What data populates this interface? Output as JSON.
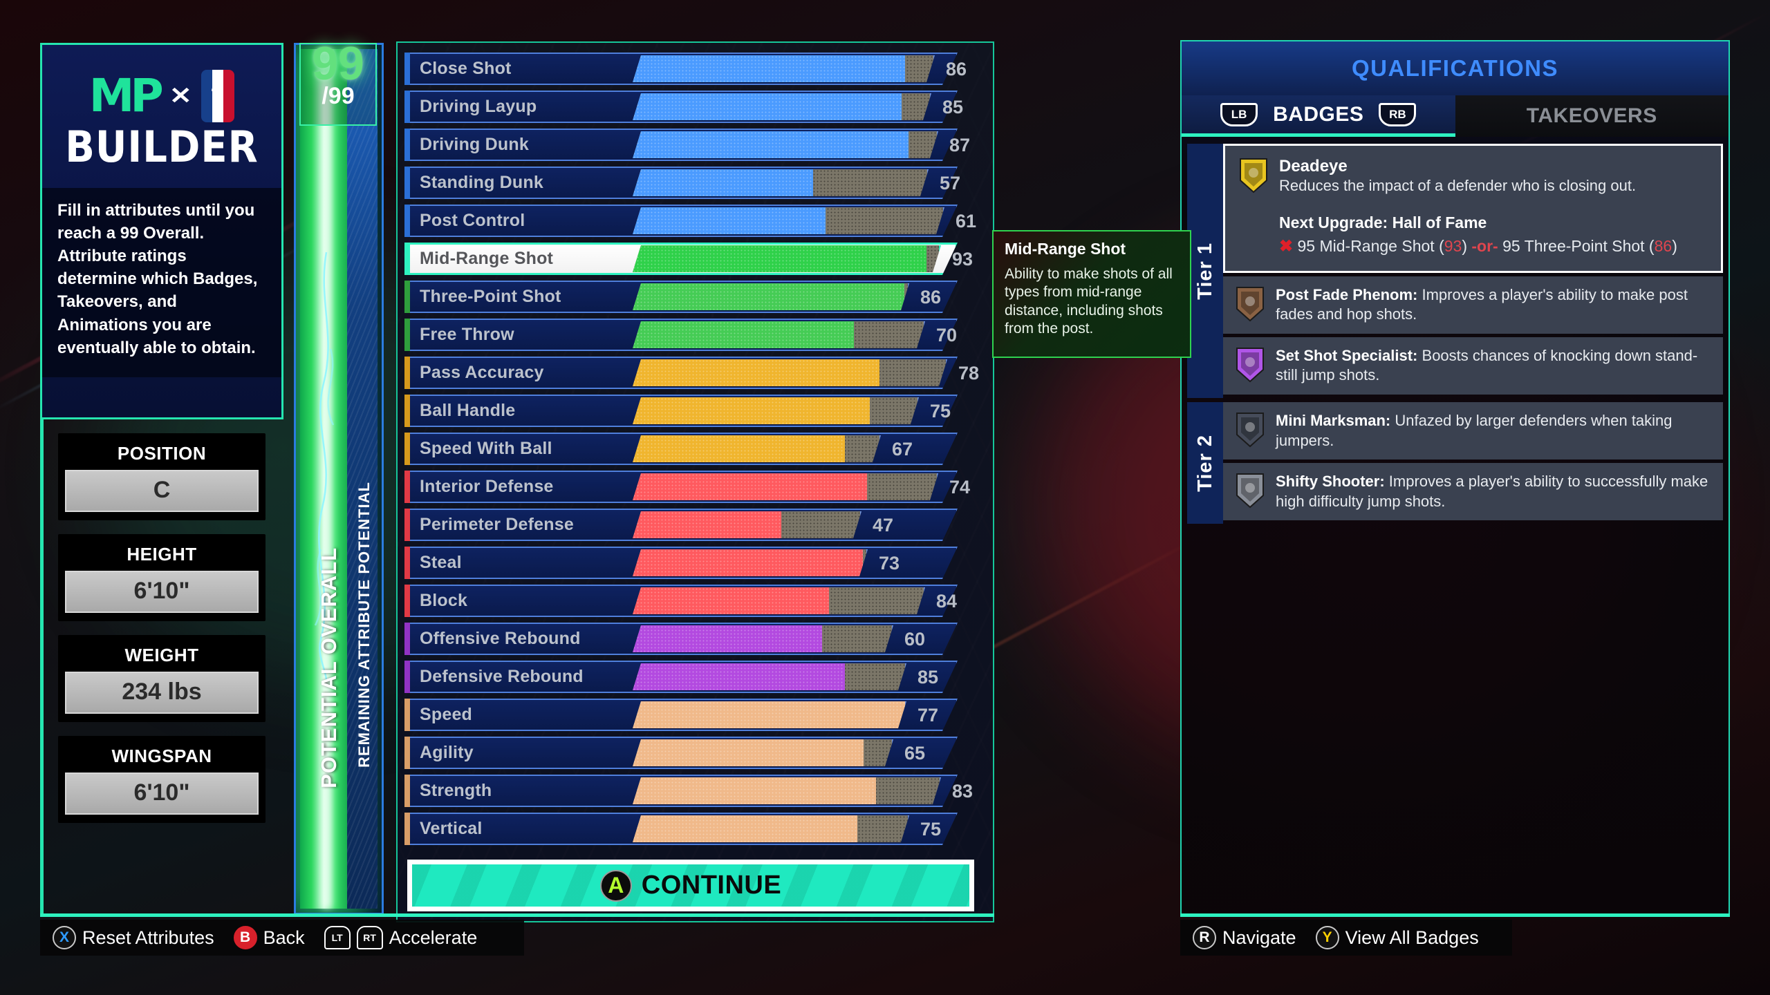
{
  "branding": {
    "mp_mark": "MP",
    "x_symbol": "✕",
    "builder_word": "BUILDER",
    "description": "Fill in attributes until you reach a 99 Overall. Attribute ratings determine which Badges, Takeovers, and Animations you are eventually able to obtain."
  },
  "player_specs": [
    {
      "label": "POSITION",
      "value": "C"
    },
    {
      "label": "HEIGHT",
      "value": "6'10\""
    },
    {
      "label": "WEIGHT",
      "value": "234 lbs"
    },
    {
      "label": "WINGSPAN",
      "value": "6'10\""
    }
  ],
  "meter": {
    "overall": "99",
    "max": "/99",
    "potential_label": "POTENTIAL OVERALL",
    "remaining_label": "REMAINING ATTRIBUTE POTENTIAL"
  },
  "attributes": [
    {
      "name": "Close Shot",
      "value": "86",
      "fill": 86,
      "potential": 95,
      "color": "#4b9bff",
      "cat": "#2b6fd6"
    },
    {
      "name": "Driving Layup",
      "value": "85",
      "fill": 85,
      "potential": 94,
      "color": "#4b9bff",
      "cat": "#2b6fd6"
    },
    {
      "name": "Driving Dunk",
      "value": "87",
      "fill": 87,
      "potential": 96,
      "color": "#4b9bff",
      "cat": "#2b6fd6"
    },
    {
      "name": "Standing Dunk",
      "value": "57",
      "fill": 57,
      "potential": 93,
      "color": "#4b9bff",
      "cat": "#2b6fd6"
    },
    {
      "name": "Post Control",
      "value": "61",
      "fill": 61,
      "potential": 98,
      "color": "#4b9bff",
      "cat": "#2b6fd6"
    },
    {
      "name": "Mid-Range Shot",
      "value": "93",
      "fill": 93,
      "potential": 97,
      "color": "#2fd14a",
      "cat": "#2ef2c0",
      "selected": true
    },
    {
      "name": "Three-Point Shot",
      "value": "86",
      "fill": 86,
      "potential": 87,
      "color": "#45cc55",
      "cat": "#2f9e3c"
    },
    {
      "name": "Free Throw",
      "value": "70",
      "fill": 70,
      "potential": 92,
      "color": "#45cc55",
      "cat": "#2f9e3c"
    },
    {
      "name": "Pass Accuracy",
      "value": "78",
      "fill": 78,
      "potential": 99,
      "color": "#f0b52e",
      "cat": "#d79a1c"
    },
    {
      "name": "Ball Handle",
      "value": "75",
      "fill": 75,
      "potential": 90,
      "color": "#f0b52e",
      "cat": "#d79a1c"
    },
    {
      "name": "Speed With Ball",
      "value": "67",
      "fill": 67,
      "potential": 78,
      "color": "#f0b52e",
      "cat": "#d79a1c"
    },
    {
      "name": "Interior Defense",
      "value": "74",
      "fill": 74,
      "potential": 96,
      "color": "#ff5a5f",
      "cat": "#e23a45"
    },
    {
      "name": "Perimeter Defense",
      "value": "47",
      "fill": 47,
      "potential": 72,
      "color": "#ff5a5f",
      "cat": "#e23a45"
    },
    {
      "name": "Steal",
      "value": "73",
      "fill": 73,
      "potential": 74,
      "color": "#ff5a5f",
      "cat": "#e23a45"
    },
    {
      "name": "Block",
      "value": "84",
      "fill": 62,
      "potential": 92,
      "color": "#ff5a5f",
      "cat": "#e23a45"
    },
    {
      "name": "Offensive Rebound",
      "value": "60",
      "fill": 60,
      "potential": 82,
      "color": "#b34ae0",
      "cat": "#9133c4"
    },
    {
      "name": "Defensive Rebound",
      "value": "85",
      "fill": 67,
      "potential": 86,
      "color": "#b34ae0",
      "cat": "#9133c4"
    },
    {
      "name": "Speed",
      "value": "77",
      "fill": 86,
      "potential": 86,
      "color": "#f0b98a",
      "cat": "#d99e67"
    },
    {
      "name": "Agility",
      "value": "65",
      "fill": 73,
      "potential": 82,
      "color": "#f0b98a",
      "cat": "#d99e67"
    },
    {
      "name": "Strength",
      "value": "83",
      "fill": 77,
      "potential": 97,
      "color": "#f0b98a",
      "cat": "#d99e67"
    },
    {
      "name": "Vertical",
      "value": "75",
      "fill": 71,
      "potential": 87,
      "color": "#f0b98a",
      "cat": "#d99e67"
    }
  ],
  "continue": {
    "button_glyph": "A",
    "label": "CONTINUE"
  },
  "tooltip": {
    "title": "Mid-Range Shot",
    "body": "Ability to make shots of all types from mid-range distance, including shots from the post."
  },
  "qualifications": {
    "title": "QUALIFICATIONS",
    "tabs": [
      {
        "label": "BADGES",
        "left_bumper": "LB",
        "right_bumper": "RB",
        "active": true
      },
      {
        "label": "TAKEOVERS",
        "active": false
      }
    ],
    "tiers": [
      {
        "label": "Tier 1",
        "badges": [
          {
            "name": "Deadeye",
            "desc": "Reduces the impact of a defender who is closing out.",
            "featured": true,
            "upgrade_title": "Next Upgrade: Hall of Fame",
            "req_mark": "✖",
            "req_a_pre": "95 Mid-Range Shot (",
            "req_a_val": "93",
            "req_a_post": ")",
            "req_or": "-or-",
            "req_b_pre": "95 Three-Point Shot (",
            "req_b_val": "86",
            "req_b_post": ")",
            "tier_color": "#e8c520"
          },
          {
            "name": "Post Fade Phenom:",
            "desc": "Improves a player's ability to make post fades and hop shots.",
            "featured": false,
            "tier_color": "#8a6244"
          },
          {
            "name": "Set Shot Specialist:",
            "desc": "Boosts chances of knocking down stand-still jump shots.",
            "featured": false,
            "tier_color": "#b056e8"
          }
        ]
      },
      {
        "label": "Tier 2",
        "badges": [
          {
            "name": "Mini Marksman:",
            "desc": "Unfazed by larger defenders when taking jumpers.",
            "featured": false,
            "tier_color": "#464c5a"
          },
          {
            "name": "Shifty Shooter:",
            "desc": "Improves a player's ability to successfully make high difficulty jump shots.",
            "featured": false,
            "tier_color": "#8a8f99"
          }
        ]
      }
    ]
  },
  "footer_left": [
    {
      "glyph": "X",
      "label": "Reset Attributes",
      "kind": "round-x"
    },
    {
      "glyph": "B",
      "label": "Back",
      "kind": "round-b"
    },
    {
      "glyph": "LT",
      "glyph2": "RT",
      "label": "Accelerate",
      "kind": "triggers"
    }
  ],
  "footer_right": [
    {
      "glyph": "R",
      "label": "Navigate",
      "kind": "round-r"
    },
    {
      "glyph": "Y",
      "label": "View All Badges",
      "kind": "round-y"
    }
  ]
}
